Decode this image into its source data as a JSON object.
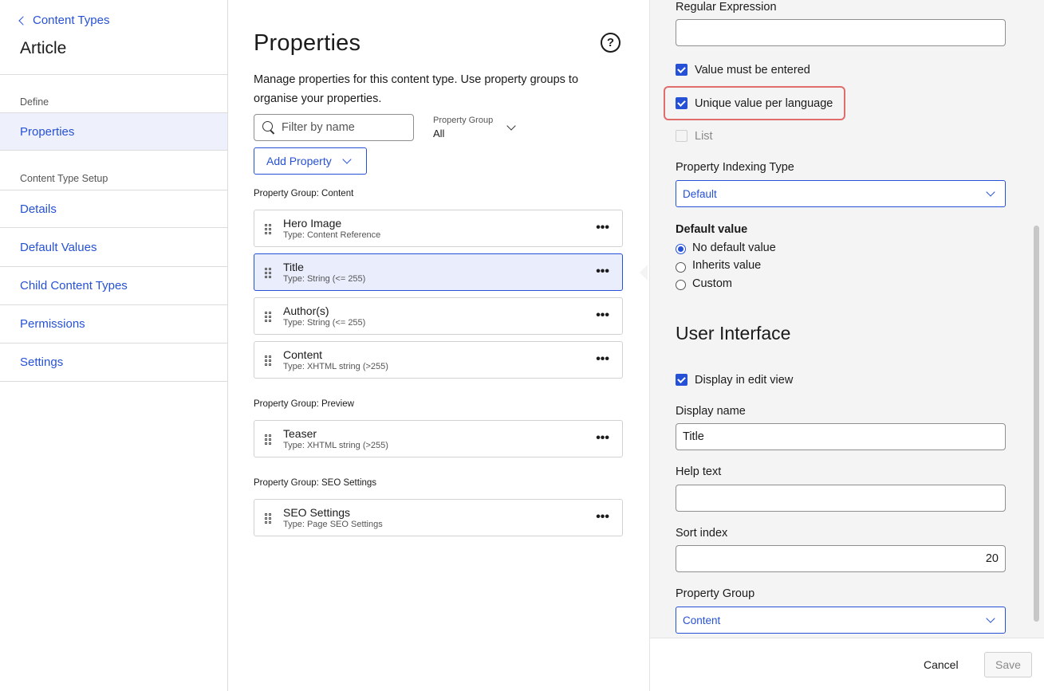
{
  "sidebar": {
    "back_label": "Content Types",
    "title": "Article",
    "sections": [
      {
        "label": "Define",
        "items": [
          {
            "label": "Properties",
            "active": true
          }
        ]
      },
      {
        "label": "Content Type Setup",
        "items": [
          {
            "label": "Details"
          },
          {
            "label": "Default Values"
          },
          {
            "label": "Child Content Types"
          },
          {
            "label": "Permissions"
          },
          {
            "label": "Settings"
          }
        ]
      }
    ]
  },
  "main": {
    "title": "Properties",
    "help_icon": "question-mark-circle-icon",
    "description": "Manage properties for this content type. Use property groups to organise your properties.",
    "filter": {
      "placeholder": "Filter by name",
      "value": ""
    },
    "property_group_filter": {
      "label": "Property Group",
      "value": "All"
    },
    "add_property_label": "Add Property",
    "groups": [
      {
        "label": "Property Group: Content",
        "properties": [
          {
            "name": "Hero Image",
            "type": "Type: Content Reference"
          },
          {
            "name": "Title",
            "type": "Type: String (<= 255)",
            "selected": true
          },
          {
            "name": "Author(s)",
            "type": "Type: String (<= 255)"
          },
          {
            "name": "Content",
            "type": "Type: XHTML string (>255)"
          }
        ]
      },
      {
        "label": "Property Group: Preview",
        "properties": [
          {
            "name": "Teaser",
            "type": "Type: XHTML string (>255)"
          }
        ]
      },
      {
        "label": "Property Group: SEO Settings",
        "properties": [
          {
            "name": "SEO Settings",
            "type": "Type: Page SEO Settings"
          }
        ]
      }
    ],
    "more_icon": "ellipsis-icon",
    "more_glyph": "•••"
  },
  "panel": {
    "regex_label": "Regular Expression",
    "regex_value": "",
    "checkboxes": {
      "value_required": {
        "label": "Value must be entered",
        "checked": true
      },
      "unique_per_language": {
        "label": "Unique value per language",
        "checked": true
      },
      "list": {
        "label": "List",
        "checked": false,
        "disabled": true
      }
    },
    "indexing_type": {
      "label": "Property Indexing Type",
      "value": "Default"
    },
    "default_value": {
      "label": "Default value",
      "options": [
        {
          "label": "No default value",
          "checked": true
        },
        {
          "label": "Inherits value",
          "checked": false
        },
        {
          "label": "Custom",
          "checked": false
        }
      ]
    },
    "ui_section_title": "User Interface",
    "display_in_edit_view": {
      "label": "Display in edit view",
      "checked": true
    },
    "display_name": {
      "label": "Display name",
      "value": "Title"
    },
    "help_text": {
      "label": "Help text",
      "value": ""
    },
    "sort_index": {
      "label": "Sort index",
      "value": "20"
    },
    "property_group": {
      "label": "Property Group",
      "value": "Content"
    },
    "footer": {
      "cancel_label": "Cancel",
      "save_label": "Save"
    }
  },
  "colors": {
    "accent": "#2651d6",
    "highlight": "#e06c6c",
    "panel_bg": "#f4f4f4",
    "selected_bg": "#eaedfc"
  }
}
